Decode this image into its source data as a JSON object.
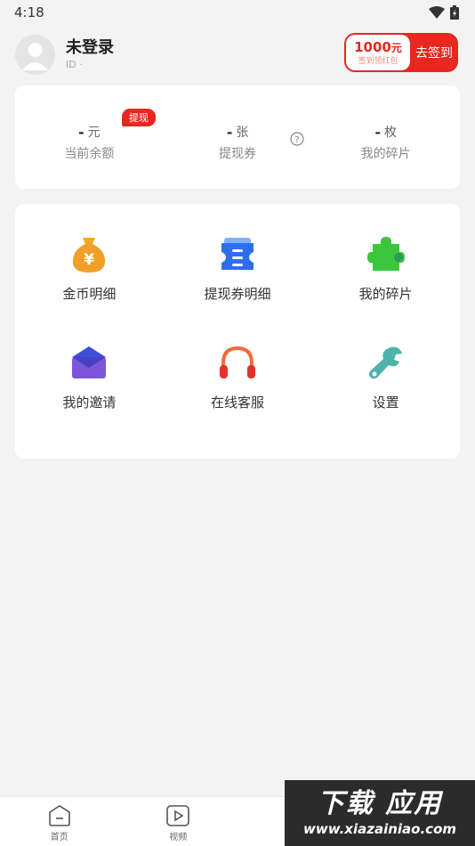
{
  "status_bar": {
    "time": "4:18"
  },
  "profile": {
    "name": "未登录",
    "id_text": "ID ·"
  },
  "sign_in": {
    "amount": "1000",
    "amount_unit": "元",
    "subtitle": "签到领红包",
    "button_label": "去签到"
  },
  "wallet": {
    "badge": "提现",
    "items": [
      {
        "value": "-",
        "unit": "元",
        "label": "当前余额"
      },
      {
        "value": "-",
        "unit": "张",
        "label": "提现券"
      },
      {
        "value": "-",
        "unit": "枚",
        "label": "我的碎片"
      }
    ]
  },
  "menu": {
    "items": [
      {
        "label": "金币明细",
        "icon": "money-bag-icon"
      },
      {
        "label": "提现券明细",
        "icon": "ticket-icon"
      },
      {
        "label": "我的碎片",
        "icon": "puzzle-icon"
      },
      {
        "label": "我的邀请",
        "icon": "envelope-icon"
      },
      {
        "label": "在线客服",
        "icon": "headphones-icon"
      },
      {
        "label": "设置",
        "icon": "wrench-icon"
      }
    ]
  },
  "tabs": [
    {
      "label": "首页",
      "icon": "home-icon"
    },
    {
      "label": "视频",
      "icon": "video-icon"
    },
    {
      "label": "",
      "icon": ""
    },
    {
      "label": "",
      "icon": ""
    }
  ],
  "watermark": {
    "title": "下载 应用",
    "url": "www.xiazainiao.com"
  },
  "colors": {
    "accent": "#e8271f",
    "background": "#f3f3f3"
  }
}
